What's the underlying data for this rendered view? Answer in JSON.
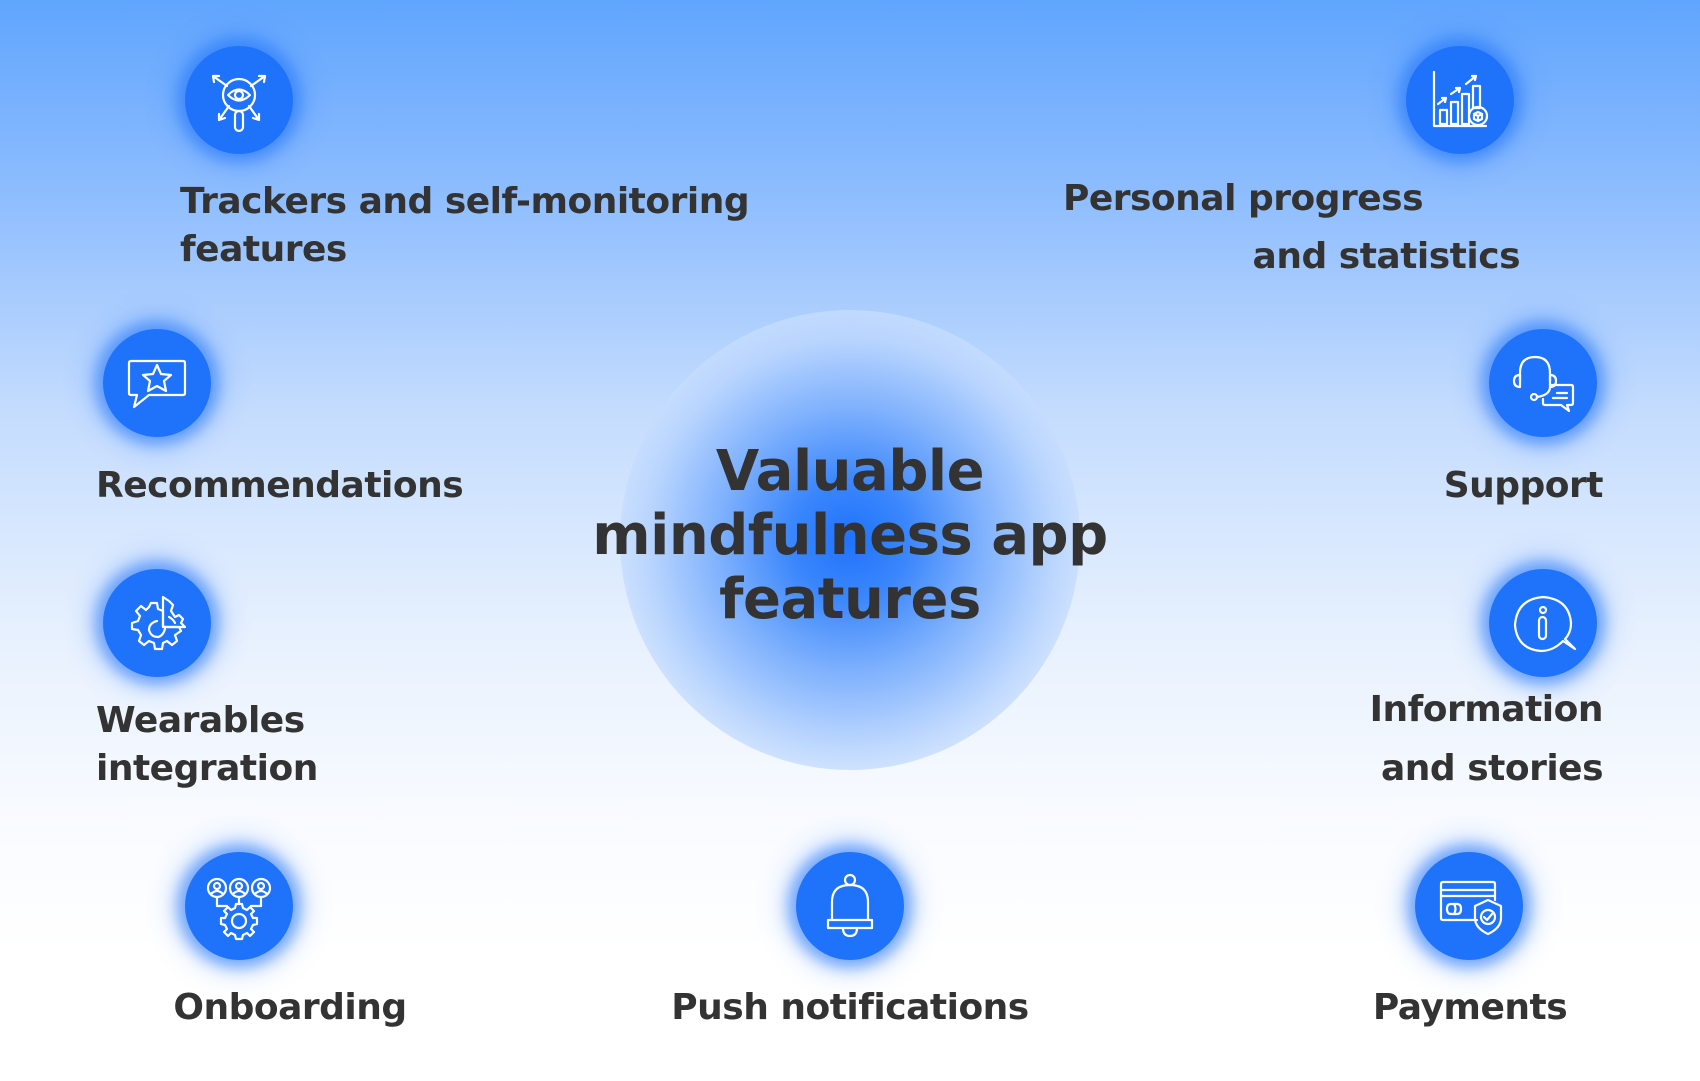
{
  "title": {
    "line1": "Valuable",
    "line2": "mindfulness app",
    "line3": "features"
  },
  "colors": {
    "accent": "#1f73fb",
    "text": "#333333",
    "icon_stroke": "#ffffff"
  },
  "features": [
    {
      "id": "trackers",
      "icon": "eye-magnifier-arrows-icon",
      "lines": [
        "Trackers and self-monitoring",
        "features"
      ]
    },
    {
      "id": "progress",
      "icon": "bar-chart-growth-icon",
      "lines": [
        "Personal progress",
        "and statistics"
      ]
    },
    {
      "id": "recommendations",
      "icon": "star-speech-bubble-icon",
      "lines": [
        "Recommendations"
      ]
    },
    {
      "id": "support",
      "icon": "headset-chat-icon",
      "lines": [
        "Support"
      ]
    },
    {
      "id": "wearables",
      "icon": "gears-icon",
      "lines": [
        "Wearables",
        "integration"
      ]
    },
    {
      "id": "information",
      "icon": "info-speech-bubble-icon",
      "lines": [
        "Information",
        "and stories"
      ]
    },
    {
      "id": "onboarding",
      "icon": "users-gear-icon",
      "lines": [
        "Onboarding"
      ]
    },
    {
      "id": "push",
      "icon": "bell-icon",
      "lines": [
        "Push notifications"
      ]
    },
    {
      "id": "payments",
      "icon": "card-shield-icon",
      "lines": [
        "Payments"
      ]
    }
  ]
}
